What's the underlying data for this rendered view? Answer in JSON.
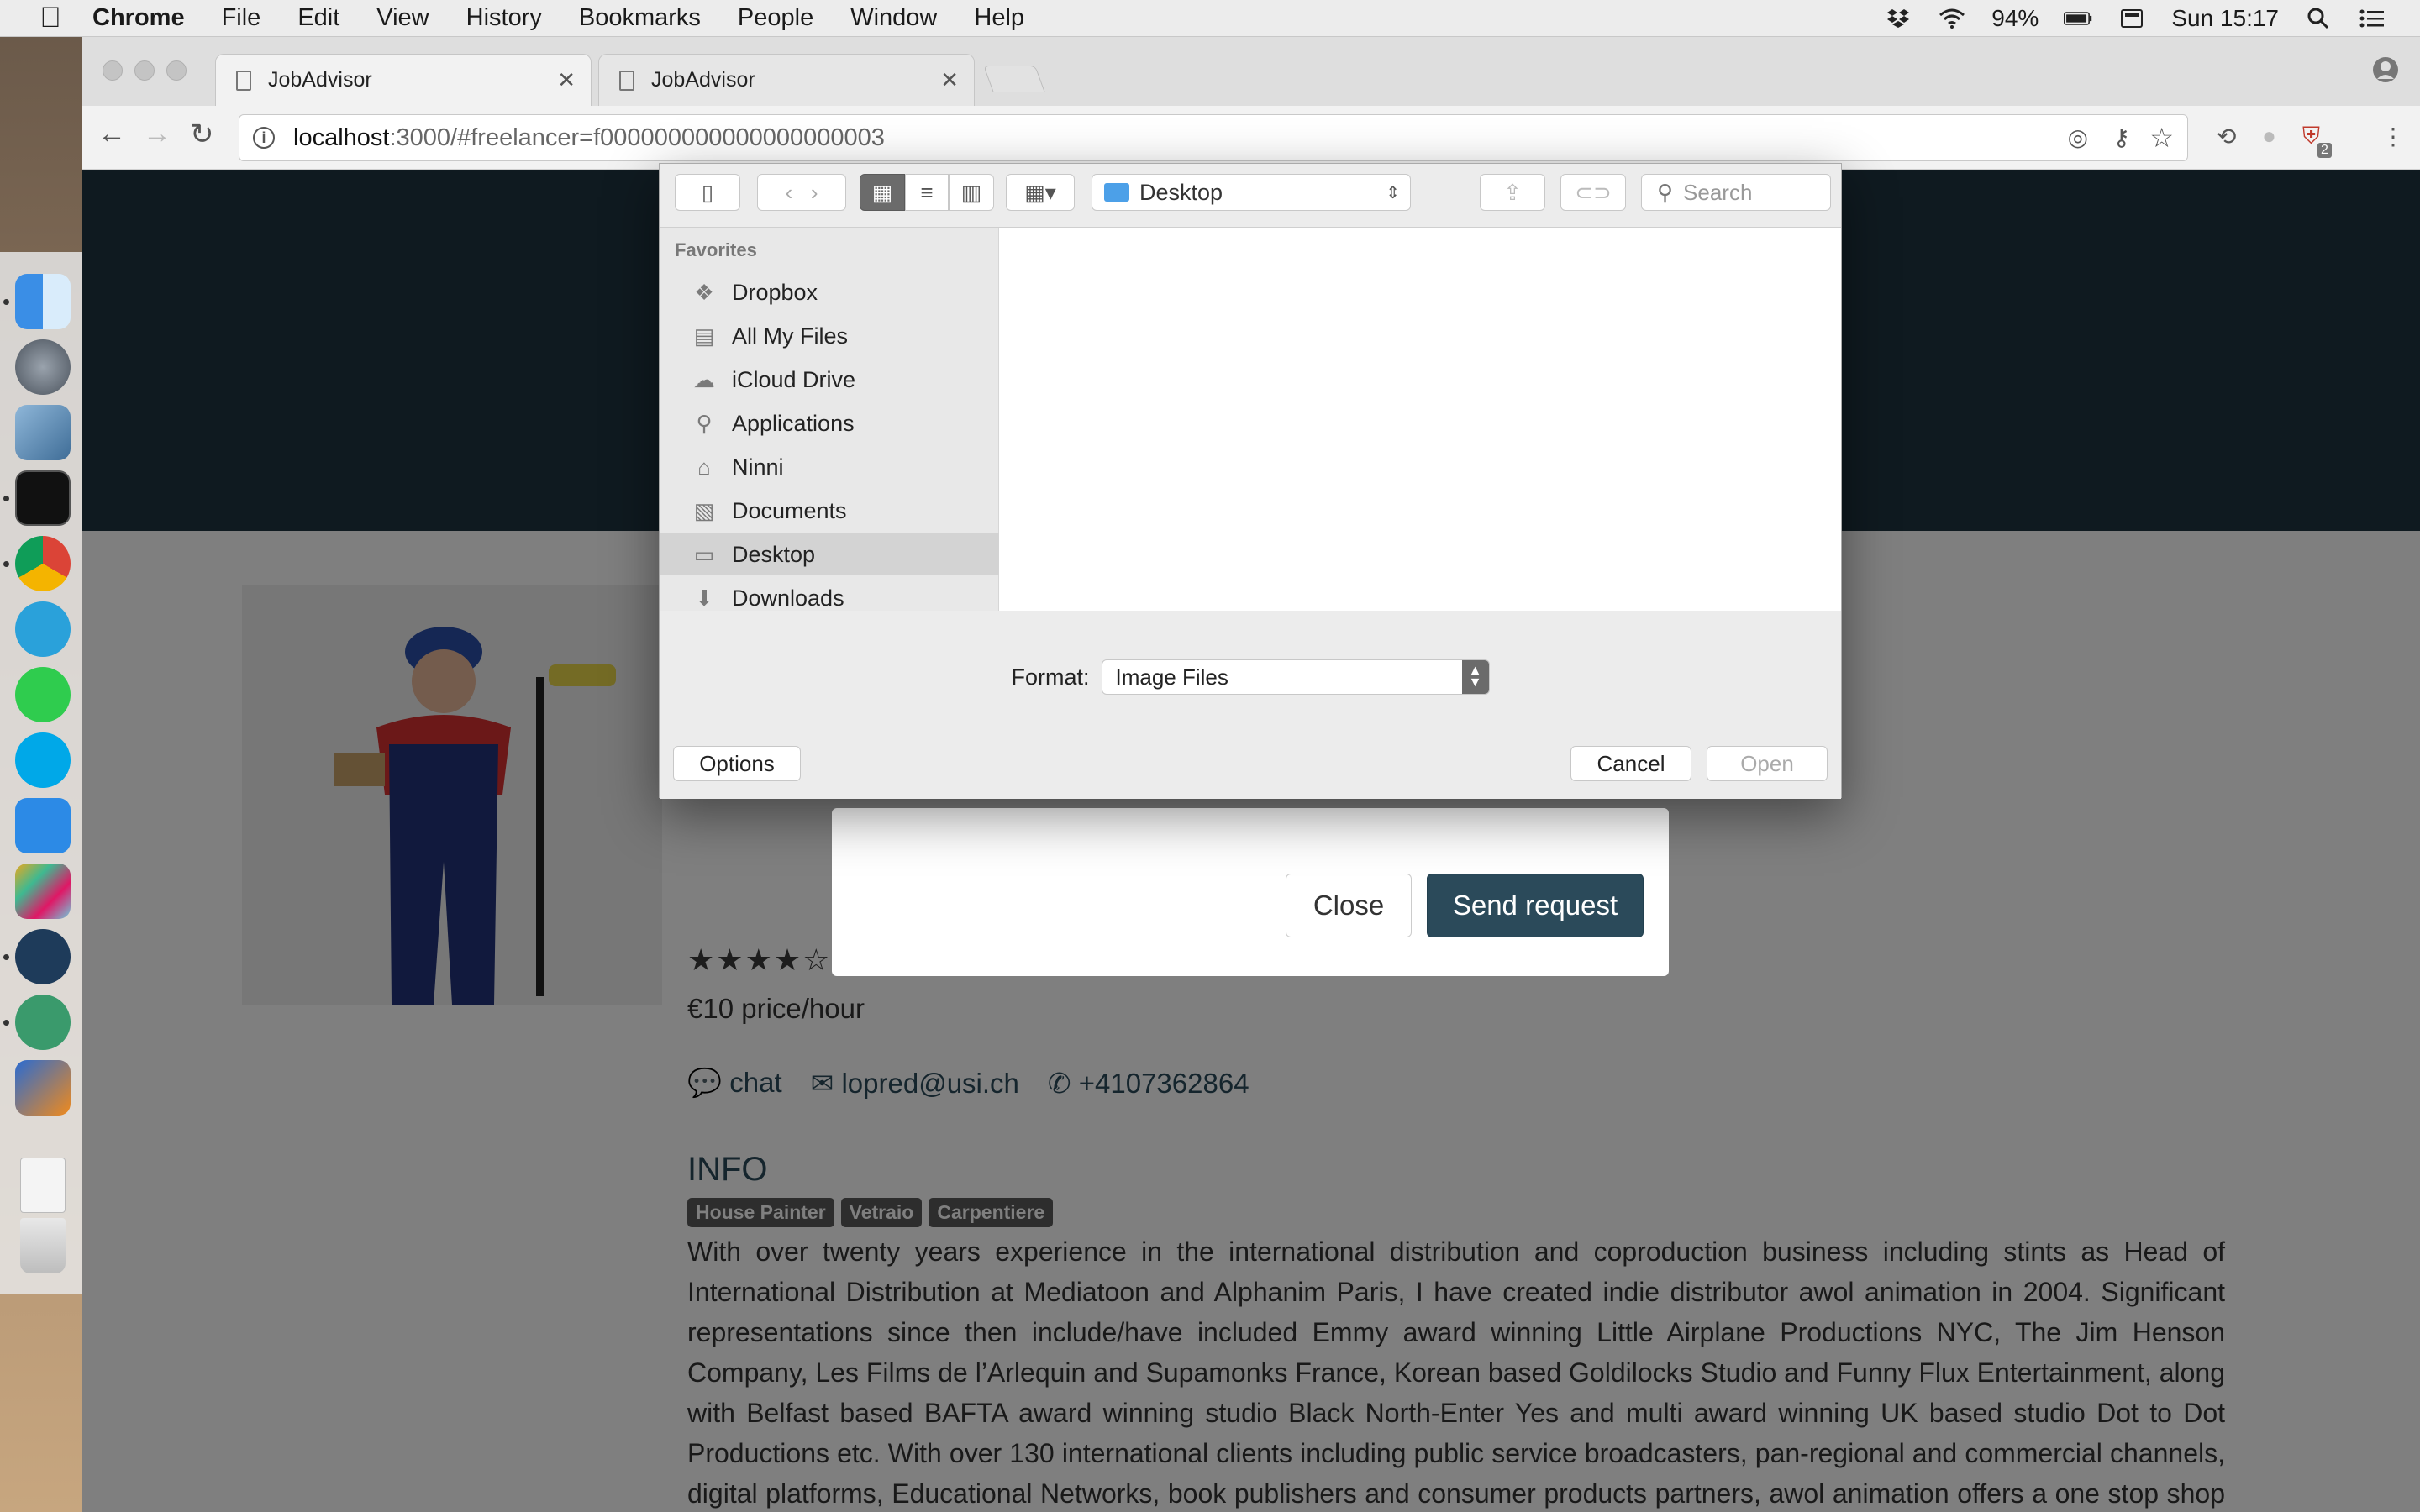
{
  "menubar": {
    "app": "Chrome",
    "items": [
      "File",
      "Edit",
      "View",
      "History",
      "Bookmarks",
      "People",
      "Window",
      "Help"
    ],
    "battery": "94%",
    "clock": "Sun 15:17"
  },
  "browser": {
    "tabs": [
      {
        "title": "JobAdvisor"
      },
      {
        "title": "JobAdvisor"
      }
    ],
    "url_host": "localhost",
    "url_path": ":3000/#freelancer=f000000000000000000003",
    "extension_badge": "2"
  },
  "profile": {
    "price": "€10 price/hour",
    "chat_label": "chat",
    "email": "lopred@usi.ch",
    "phone": "+4107362864",
    "rating": 4,
    "rating_max": 5,
    "info_title": "INFO",
    "tags": [
      "House Painter",
      "Vetraio",
      "Carpentiere"
    ],
    "description": "With over twenty years experience in the international distribution and coproduction business including stints as Head of International Distribution at Mediatoon and Alphanim Paris, I have created indie distributor awol animation in 2004. Significant representations since then include/have included Emmy award winning Little Airplane Productions NYC, The Jim Henson Company, Les Films de l’Arlequin and Supamonks France, Korean based Goldilocks Studio and Funny Flux Entertainment, along with Belfast based BAFTA award winning studio Black North-Enter Yes and multi award winning UK based studio Dot to Dot Productions etc. With over 130 international clients including public service broadcasters, pan-regional and commercial channels, digital platforms, Educational Networks, book publishers and consumer products partners, awol animation offers a one stop shop vertically integrated roll out for new brands."
  },
  "modal": {
    "close_label": "Close",
    "send_label": "Send request"
  },
  "file_dialog": {
    "location": "Desktop",
    "search_placeholder": "Search",
    "favorites_heading": "Favorites",
    "favorites": [
      {
        "label": "Dropbox",
        "icon": "dropbox-icon"
      },
      {
        "label": "All My Files",
        "icon": "all-files-icon"
      },
      {
        "label": "iCloud Drive",
        "icon": "cloud-icon"
      },
      {
        "label": "Applications",
        "icon": "applications-icon"
      },
      {
        "label": "Ninni",
        "icon": "home-icon"
      },
      {
        "label": "Documents",
        "icon": "documents-icon"
      },
      {
        "label": "Desktop",
        "icon": "desktop-icon"
      },
      {
        "label": "Downloads",
        "icon": "downloads-icon"
      }
    ],
    "selected_favorite": "Desktop",
    "format_label": "Format:",
    "format_value": "Image Files",
    "options_label": "Options",
    "cancel_label": "Cancel",
    "open_label": "Open"
  },
  "colors": {
    "hero": "#1f3441",
    "accent": "#2b4a5a"
  }
}
